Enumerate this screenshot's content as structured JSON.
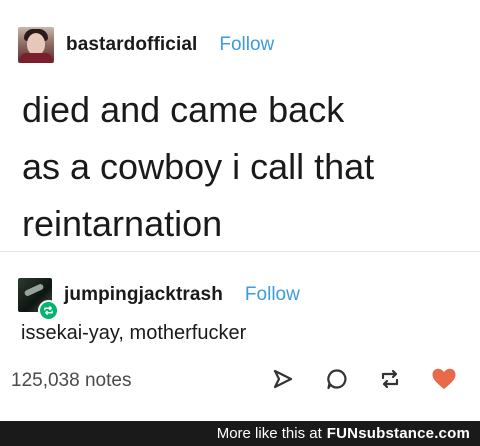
{
  "original_post": {
    "username": "bastardofficial",
    "follow_label": "Follow",
    "lines": [
      "died and came back",
      "as a cowboy i call that",
      "reintarnation"
    ]
  },
  "reblog": {
    "username": "jumpingjacktrash",
    "follow_label": "Follow",
    "text": "issekai-yay, motherfucker"
  },
  "footer_bar": {
    "notes_count": "125,038 notes",
    "actions": [
      "share-icon",
      "reply-icon",
      "reblog-icon",
      "like-icon"
    ],
    "like_color": "#e86a4a"
  },
  "watermark": {
    "text": "More like this at",
    "brand": "FUNsubstance.com"
  },
  "colors": {
    "follow": "#3d9bde",
    "reblog_badge": "#00b66e",
    "watermark_bg": "#1a1a1a"
  }
}
